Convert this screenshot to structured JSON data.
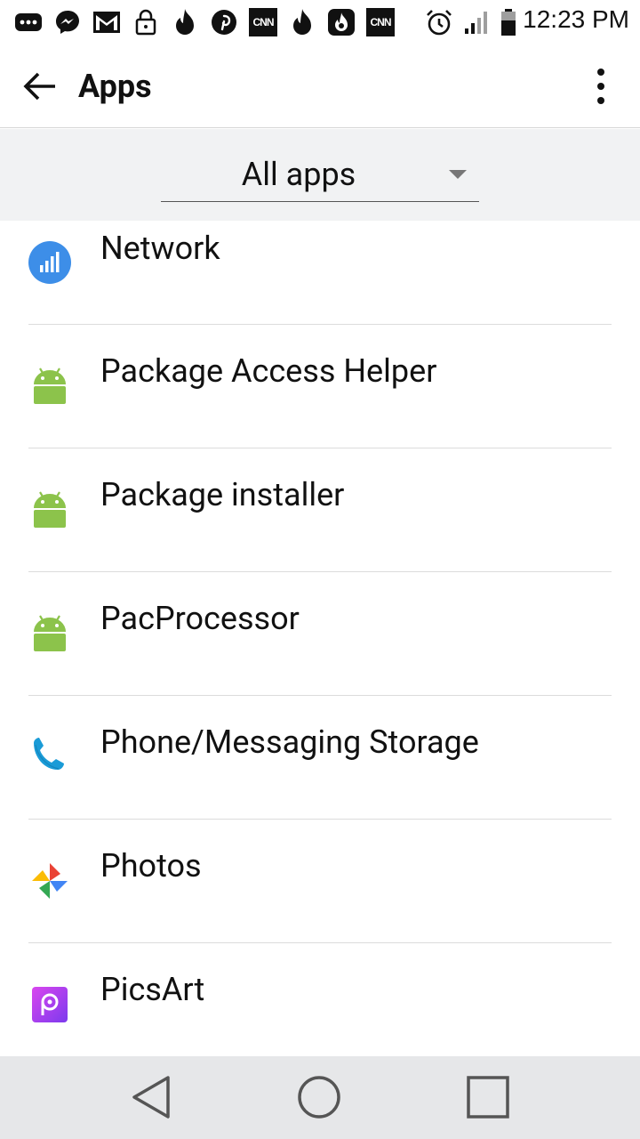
{
  "status_bar": {
    "time": "12:23 PM",
    "notification_icons": [
      "more-icon",
      "messenger-icon",
      "gmail-icon",
      "lock-icon",
      "tinder-icon",
      "pinterest-icon",
      "cnn-icon",
      "tinder-icon",
      "tinder-box-icon",
      "cnn-icon"
    ],
    "cnn_text": "CNN"
  },
  "app_bar": {
    "title": "Apps"
  },
  "filter": {
    "selected": "All apps"
  },
  "apps": [
    {
      "label": "Network",
      "icon": "network-icon"
    },
    {
      "label": "Package Access Helper",
      "icon": "android-icon"
    },
    {
      "label": "Package installer",
      "icon": "android-icon"
    },
    {
      "label": "PacProcessor",
      "icon": "android-icon"
    },
    {
      "label": "Phone/Messaging Storage",
      "icon": "phone-icon"
    },
    {
      "label": "Photos",
      "icon": "photos-icon"
    },
    {
      "label": "PicsArt",
      "icon": "picsart-icon"
    }
  ],
  "colors": {
    "android_green": "#8cc34b",
    "network_blue": "#3d8ee8",
    "phone_blue": "#1a9bd7"
  }
}
